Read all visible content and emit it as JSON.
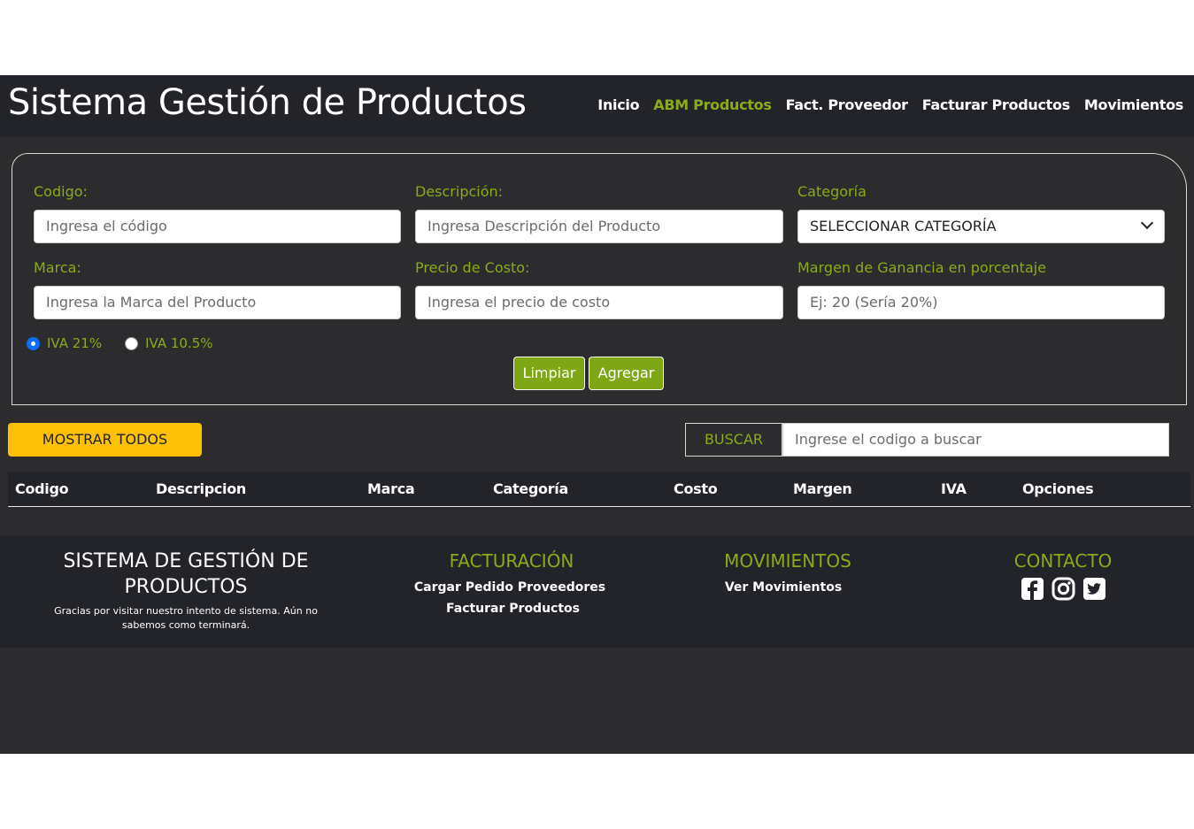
{
  "navbar": {
    "brand": "Sistema Gestión de Productos",
    "links": [
      "Inicio",
      "ABM Productos",
      "Fact. Proveedor",
      "Facturar Productos",
      "Movimientos"
    ],
    "active": "ABM Productos"
  },
  "form": {
    "codigo_label": "Codigo:",
    "codigo_placeholder": "Ingresa el código",
    "descripcion_label": "Descripción:",
    "descripcion_placeholder": "Ingresa Descripción del Producto",
    "categoria_label": "Categoría",
    "categoria_value": "SELECCIONAR CATEGORÍA",
    "marca_label": "Marca:",
    "marca_placeholder": "Ingresa la Marca del Producto",
    "precio_label": "Precio de Costo:",
    "precio_placeholder": "Ingresa el precio de costo",
    "margen_label": "Margen de Ganancia en porcentaje",
    "margen_placeholder": "Ej: 20 (Sería 20%)",
    "iva_options": [
      "IVA 21%",
      "IVA 10.5%"
    ],
    "iva_selected": "IVA 21%",
    "limpiar_label": "Limpiar",
    "agregar_label": "Agregar"
  },
  "search": {
    "mostrar_label": "MOSTRAR TODOS",
    "buscar_label": "BUSCAR",
    "placeholder": "Ingrese el codigo a buscar"
  },
  "table": {
    "headers": [
      "Codigo",
      "Descripcion",
      "Marca",
      "Categoría",
      "Costo",
      "Margen",
      "IVA",
      "Opciones"
    ]
  },
  "footer": {
    "title": "SISTEMA DE GESTIÓN DE PRODUCTOS",
    "subtitle": "Gracias por visitar nuestro intento de sistema. Aún no sabemos como terminará.",
    "facturacion_head": "FACTURACIÓN",
    "facturacion_links": [
      "Cargar Pedido Proveedores",
      "Facturar Productos"
    ],
    "movimientos_head": "MOVIMIENTOS",
    "movimientos_links": [
      "Ver Movimientos"
    ],
    "contacto_head": "CONTACTO",
    "socials": [
      "facebook-icon",
      "instagram-icon",
      "twitter-icon"
    ]
  },
  "colors": {
    "accent": "#8aab1a",
    "button_green": "#7ea615",
    "button_yellow": "#ffc107",
    "navbar_bg": "#232429",
    "page_bg": "#2c2c2e"
  }
}
